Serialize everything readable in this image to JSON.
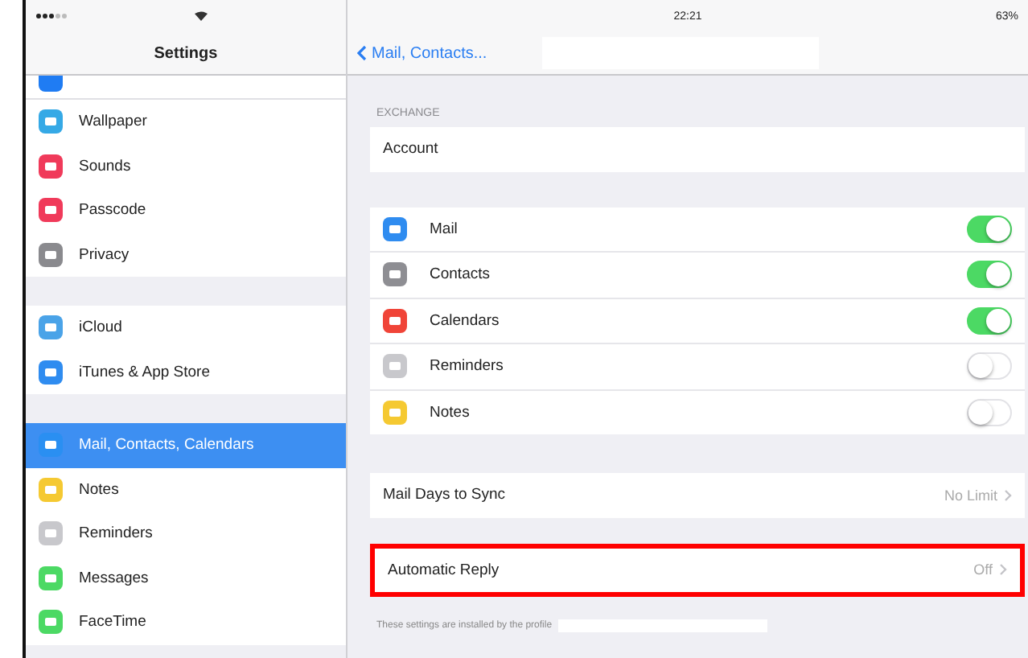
{
  "status_bar": {
    "time": "22:21",
    "battery": "63%"
  },
  "sidebar": {
    "title": "Settings",
    "partial_item": {
      "color": "#1f7cf3"
    },
    "groups": [
      {
        "items": [
          {
            "label": "Wallpaper",
            "color": "#35a9e6",
            "selected": false
          },
          {
            "label": "Sounds",
            "color": "#f03a5a",
            "selected": false
          },
          {
            "label": "Passcode",
            "color": "#f03a5a",
            "selected": false
          },
          {
            "label": "Privacy",
            "color": "#8a8a8e",
            "selected": false
          }
        ]
      },
      {
        "items": [
          {
            "label": "iCloud",
            "color": "#4aa3e8",
            "selected": false
          },
          {
            "label": "iTunes & App Store",
            "color": "#2f8cf0",
            "selected": false
          }
        ]
      },
      {
        "items": [
          {
            "label": "Mail, Contacts, Calendars",
            "color": "#2a8ff2",
            "selected": true
          },
          {
            "label": "Notes",
            "color": "#f5c932",
            "selected": false
          },
          {
            "label": "Reminders",
            "color": "#c8c8cc",
            "selected": false
          },
          {
            "label": "Messages",
            "color": "#4cd964",
            "selected": false
          },
          {
            "label": "FaceTime",
            "color": "#4cd964",
            "selected": false
          }
        ]
      }
    ]
  },
  "detail": {
    "back": "Mail, Contacts...",
    "sections": [
      {
        "header": "EXCHANGE",
        "highlighted": false,
        "rows": [
          {
            "kind": "link",
            "label": "Account"
          }
        ]
      },
      {
        "highlighted": false,
        "rows": [
          {
            "kind": "toggle",
            "label": "Mail",
            "color": "#2f8cf0",
            "on": true
          },
          {
            "kind": "toggle",
            "label": "Contacts",
            "color": "#8e8e93",
            "on": true
          },
          {
            "kind": "toggle",
            "label": "Calendars",
            "color": "#f04438",
            "on": true
          },
          {
            "kind": "toggle",
            "label": "Reminders",
            "color": "#c8c8cc",
            "on": false
          },
          {
            "kind": "toggle",
            "label": "Notes",
            "color": "#f5c932",
            "on": false
          }
        ]
      },
      {
        "highlighted": false,
        "rows": [
          {
            "kind": "link",
            "label": "Mail Days to Sync",
            "value": "No Limit"
          }
        ]
      },
      {
        "highlighted": true,
        "rows": [
          {
            "kind": "link",
            "label": "Automatic Reply",
            "value": "Off"
          }
        ]
      }
    ],
    "footer": "These settings are installed by the profile"
  }
}
